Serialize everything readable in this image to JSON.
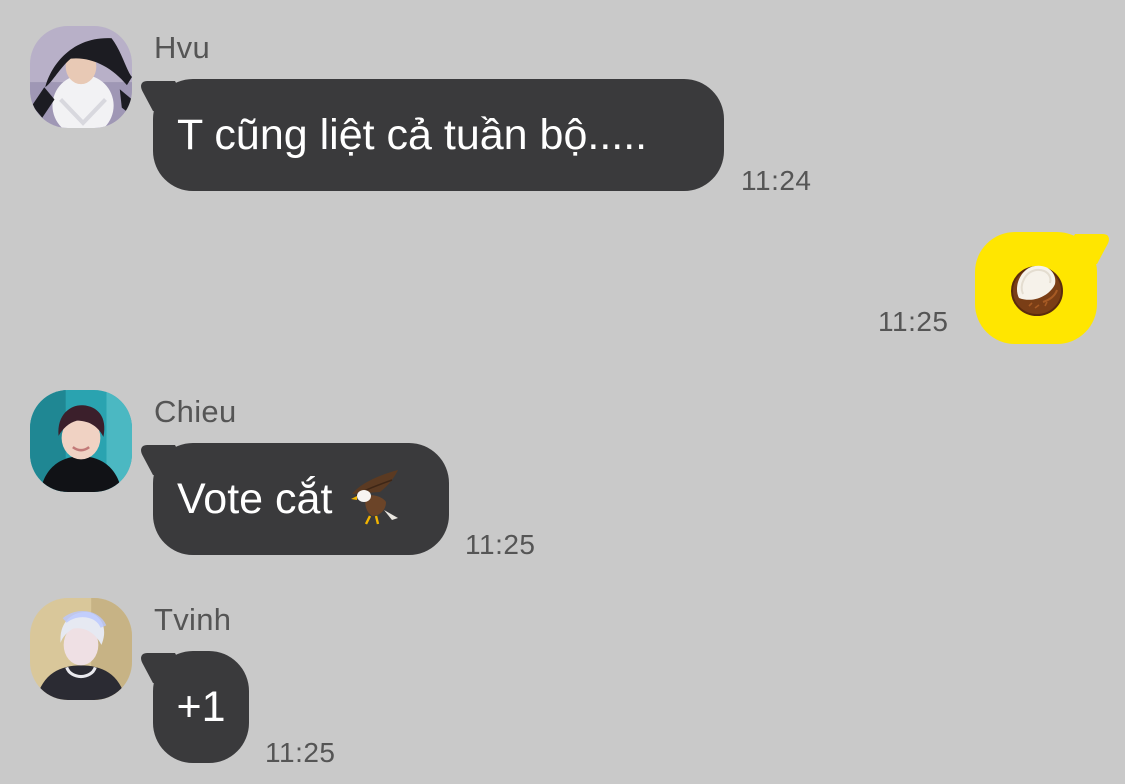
{
  "messages": [
    {
      "sender": "Hvu",
      "text": "T cũng liệt cả tuần bộ.....",
      "time": "11:24",
      "direction": "incoming"
    },
    {
      "sender": "",
      "text": "",
      "emoji": "coconut-emoji",
      "time": "11:25",
      "direction": "outgoing"
    },
    {
      "sender": "Chieu",
      "text": "Vote cắt",
      "emoji": "eagle-emoji",
      "time": "11:25",
      "direction": "incoming"
    },
    {
      "sender": "Tvinh",
      "text": "+1",
      "time": "11:25",
      "direction": "incoming"
    }
  ],
  "colors": {
    "background": "#c9c9c9",
    "incoming_bubble": "#3a3a3c",
    "outgoing_bubble": "#ffe600",
    "meta_text": "#555555"
  }
}
